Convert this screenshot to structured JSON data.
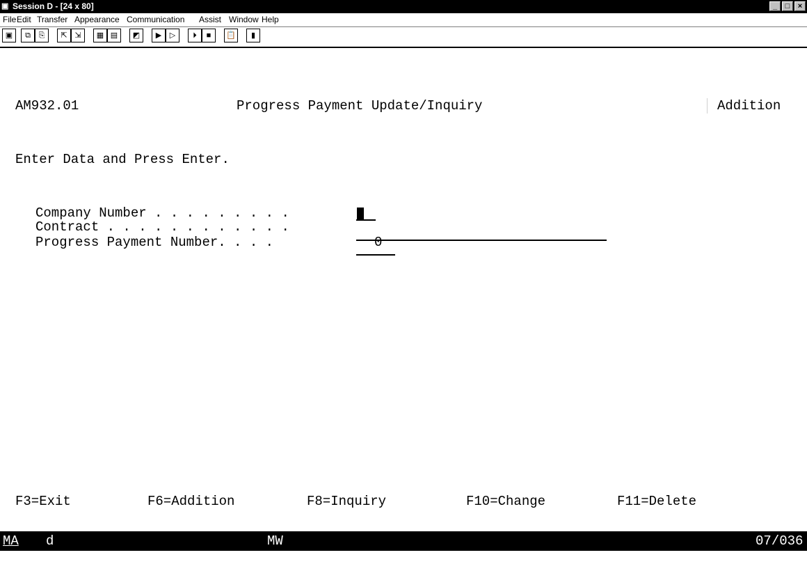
{
  "window": {
    "title": "Session D - [24 x 80]",
    "controls": [
      "_",
      "□",
      "×"
    ]
  },
  "menu": [
    "File",
    "Edit",
    "Transfer",
    "Appearance",
    "Communication",
    "Assist",
    "Window",
    "Help"
  ],
  "toolbar_icons": [
    "print-screen-icon",
    "copy-icon",
    "paste-icon",
    "send-file-icon",
    "receive-file-icon",
    "keypad-icon",
    "display-icon",
    "macro-icon",
    "record-macro-icon",
    "play-macro-icon",
    "start-icon",
    "stop-icon",
    "clipboard-icon",
    "help-book-icon"
  ],
  "screen": {
    "program_id": "AM932.01",
    "title": "Progress Payment Update/Inquiry",
    "mode": "Addition",
    "instruction": "Enter Data and Press Enter.",
    "fields": [
      {
        "label": "Company Number . . . . . . . . .",
        "value": ""
      },
      {
        "label": "Contract . . . . . . . . . . . .",
        "value": ""
      },
      {
        "label": "Progress Payment Number. . . .",
        "value": "0"
      }
    ],
    "function_keys": [
      "F3=Exit",
      "F6=Addition",
      "F8=Inquiry",
      "F10=Change",
      "F11=Delete"
    ]
  },
  "status_bar": {
    "left": "MA",
    "indicator": "d",
    "middle": "MW",
    "position": "07/036"
  }
}
